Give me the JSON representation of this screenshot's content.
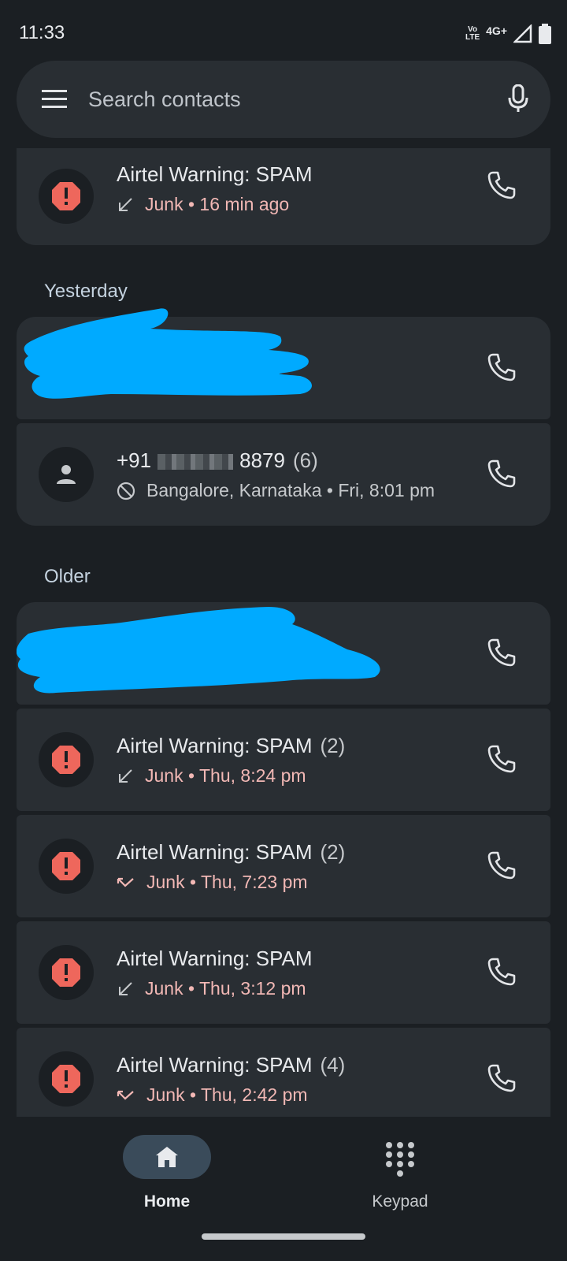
{
  "status": {
    "time": "11:33",
    "volte_top": "Vo",
    "volte_bottom": "LTE",
    "network": "4G+"
  },
  "search": {
    "placeholder": "Search contacts"
  },
  "calls_top": [
    {
      "title": "Airtel Warning: SPAM",
      "detail": "Junk • 16 min ago",
      "type": "incoming"
    }
  ],
  "sections": {
    "yesterday": "Yesterday",
    "older": "Older"
  },
  "yesterday_calls": [
    {
      "title_prefix": "+91",
      "title_suffix": "8879",
      "count": "(6)",
      "detail": "Bangalore, Karnataka • Fri, 8:01 pm",
      "type": "blocked"
    }
  ],
  "older_calls": [
    {
      "title": "Airtel Warning: SPAM",
      "count": "(2)",
      "detail": "Junk • Thu, 8:24 pm",
      "type": "incoming"
    },
    {
      "title": "Airtel Warning: SPAM",
      "count": "(2)",
      "detail": "Junk • Thu, 7:23 pm",
      "type": "missed"
    },
    {
      "title": "Airtel Warning: SPAM",
      "count": "",
      "detail": "Junk • Thu, 3:12 pm",
      "type": "incoming"
    },
    {
      "title": "Airtel Warning: SPAM",
      "count": "(4)",
      "detail": "Junk • Thu, 2:42 pm",
      "type": "missed"
    }
  ],
  "nav": {
    "home": "Home",
    "keypad": "Keypad"
  },
  "colors": {
    "background": "#1b1f23",
    "card": "#292e33",
    "junk_text": "#f2b8b5",
    "spam_icon": "#ee675c",
    "redaction": "#00aaff",
    "nav_active": "#3a4b5a"
  }
}
